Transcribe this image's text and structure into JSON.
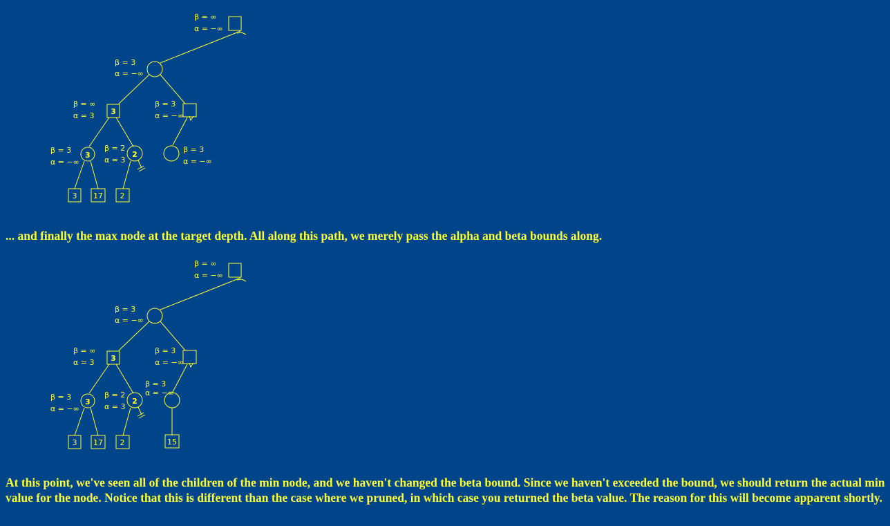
{
  "colors": {
    "background": "#00448a",
    "foreground": "#ffff33"
  },
  "paragraphs": {
    "p1": "... and finally the max node at the target depth. All along this path, we merely pass the alpha and beta bounds along.",
    "p2": "At this point, we've seen all of the children of the min node, and we haven't changed the beta bound. Since we haven't exceeded the bound, we should return the actual min value for the node. Notice that this is different than the case where we pruned, in which case you returned the beta value. The reason for this will become apparent shortly."
  },
  "diagram1": {
    "root": {
      "beta": "β = ∞",
      "alpha": "α = −∞"
    },
    "min1": {
      "beta": "β = 3",
      "alpha": "α = −∞"
    },
    "maxL": {
      "value": "3",
      "beta": "β = ∞",
      "alpha": "α = 3"
    },
    "maxR": {
      "beta": "β = 3",
      "alpha": "α = −∞"
    },
    "minLL": {
      "value": "3",
      "beta": "β = 3",
      "alpha": "α = −∞"
    },
    "minLR": {
      "value": "2",
      "beta": "β = 2",
      "alpha": "α = 3"
    },
    "minRL": {
      "beta": "β = 3",
      "alpha": "α = −∞"
    },
    "leaves": [
      "3",
      "17",
      "2"
    ]
  },
  "diagram2": {
    "root": {
      "beta": "β = ∞",
      "alpha": "α = −∞"
    },
    "min1": {
      "beta": "β = 3",
      "alpha": "α = −∞"
    },
    "maxL": {
      "value": "3",
      "beta": "β = ∞",
      "alpha": "α = 3"
    },
    "maxR": {
      "beta": "β = 3",
      "alpha": "α = −∞"
    },
    "minLL": {
      "value": "3",
      "beta": "β = 3",
      "alpha": "α = −∞"
    },
    "minLR": {
      "value": "2",
      "beta": "β = 2",
      "alpha": "α = 3"
    },
    "minRL": {
      "beta": "β = 3",
      "alpha": "α = −∞"
    },
    "leaves": [
      "3",
      "17",
      "2",
      "15"
    ]
  }
}
